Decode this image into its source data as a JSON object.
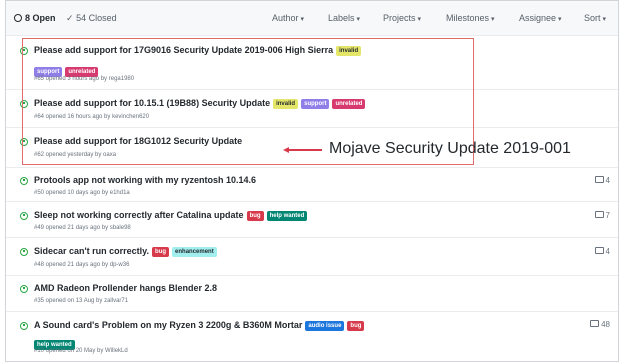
{
  "header": {
    "open_count": "8 Open",
    "closed_count": "54 Closed",
    "filters": {
      "author": "Author",
      "labels": "Labels",
      "projects": "Projects",
      "milestones": "Milestones",
      "assignee": "Assignee",
      "sort": "Sort"
    }
  },
  "colors": {
    "open_icon": "#28a745",
    "invalid": "#e4e669",
    "support": "#8f7ee7",
    "unrelated": "#d73a6e",
    "bug": "#d73a4a",
    "help_wanted": "#008672",
    "enhancement": "#a2eeef",
    "audio_issue": "#1d76db",
    "highlight_border": "#e26b6b"
  },
  "issues": [
    {
      "title": "Please add support for 17G9016 Security Update 2019-006 High Sierra",
      "labels": [
        "invalid",
        "support",
        "unrelated"
      ],
      "meta": "#65 opened 3 hours ago by rega1980"
    },
    {
      "title": "Please add support for 10.15.1 (19B88) Security Update",
      "labels": [
        "invalid",
        "support",
        "unrelated"
      ],
      "meta": "#64 opened 16 hours ago by kevinchen620"
    },
    {
      "title": "Please add support for 18G1012 Security Update",
      "labels": [],
      "meta": "#62 opened yesterday by oaxa"
    },
    {
      "title": "Protools app not working with my ryzentosh 10.14.6",
      "labels": [],
      "meta": "#50 opened 10 days ago by e1hd1a",
      "comments": "4"
    },
    {
      "title": "Sleep not working correctly after Catalina update",
      "labels": [
        "bug",
        "help wanted"
      ],
      "meta": "#49 opened 21 days ago by sbale98",
      "comments": "7"
    },
    {
      "title": "Sidecar can't run correctly.",
      "labels": [
        "bug",
        "enhancement"
      ],
      "meta": "#48 opened 21 days ago by dp-w36",
      "comments": "4"
    },
    {
      "title": "AMD Radeon Prollender hangs Blender 2.8",
      "labels": [],
      "meta": "#35 opened on 13 Aug by zallvar71"
    },
    {
      "title": "A Sound card's Problem on my Ryzen 3 2200g & B360M Mortar",
      "labels": [
        "audio issue",
        "bug",
        "help wanted"
      ],
      "meta": "#10 opened on 20 May by WillekLd",
      "comments": "48"
    }
  ],
  "annotation": "Mojave Security Update 2019-001"
}
